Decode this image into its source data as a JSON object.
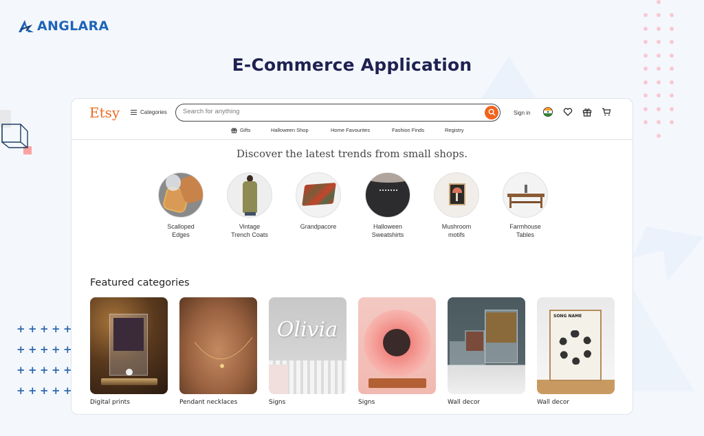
{
  "brand": {
    "name": "ANGLARA",
    "color": "#1f64b8"
  },
  "page_title": "E-Commerce Application",
  "etsy": {
    "logo": "Etsy",
    "accent": "#f1641e",
    "header": {
      "categories_label": "Categories",
      "search": {
        "placeholder": "Search for anything",
        "value": ""
      },
      "sign_in": "Sign in",
      "icons": [
        "india-flag-icon",
        "heart-icon",
        "gift-icon",
        "cart-icon"
      ]
    },
    "subnav": [
      {
        "label": "Gifts",
        "icon": "gift-icon"
      },
      {
        "label": "Halloween Shop"
      },
      {
        "label": "Home Favourites"
      },
      {
        "label": "Fashion Finds"
      },
      {
        "label": "Registry"
      }
    ],
    "discover_heading": "Discover the latest trends from small shops.",
    "trends": [
      {
        "label": "Scalloped\nEdges"
      },
      {
        "label": "Vintage\nTrench Coats"
      },
      {
        "label": "Grandpacore"
      },
      {
        "label": "Halloween\nSweatshirts"
      },
      {
        "label": "Mushroom\nmotifs"
      },
      {
        "label": "Farmhouse\nTables"
      }
    ],
    "featured": {
      "title": "Featured categories",
      "items": [
        {
          "label": "Digital prints"
        },
        {
          "label": "Pendant necklaces"
        },
        {
          "label": "Signs",
          "image_text": "Olivia"
        },
        {
          "label": "Signs"
        },
        {
          "label": "Wall decor"
        },
        {
          "label": "Wall decor",
          "image_text": "SONG NAME"
        }
      ]
    }
  }
}
